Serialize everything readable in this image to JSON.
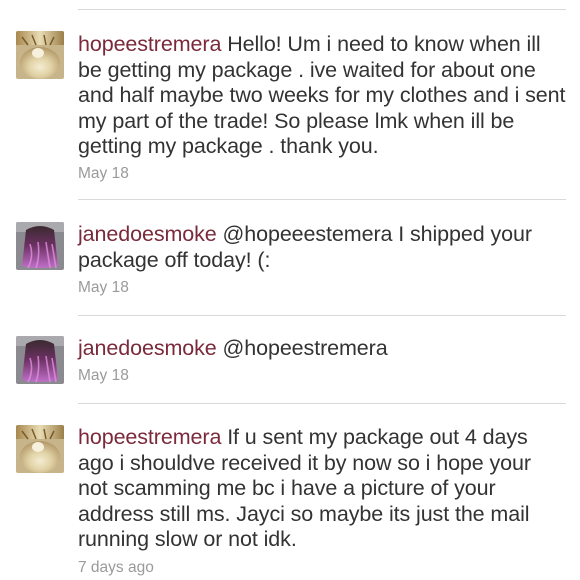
{
  "tweets": [
    {
      "username": "hopeestremera",
      "text": "Hello! Um i need to know when ill be getting my package . ive waited for about one and half maybe two weeks for my clothes and i sent my part of the trade! So please lmk when ill be getting my package . thank you.",
      "time": "May 18"
    },
    {
      "username": "janedoesmoke",
      "text": "@hopeeestemera I shipped your package off today! (:",
      "time": "May 18"
    },
    {
      "username": "janedoesmoke",
      "text": "@hopeestremera",
      "time": "May 18"
    },
    {
      "username": "hopeestremera",
      "text": "If u sent my package out 4 days ago i shouldve received it by now so i hope your not scamming me bc i have a picture of your address still ms. Jayci so maybe its just the mail running slow or not idk.",
      "time": "7 days ago"
    }
  ]
}
